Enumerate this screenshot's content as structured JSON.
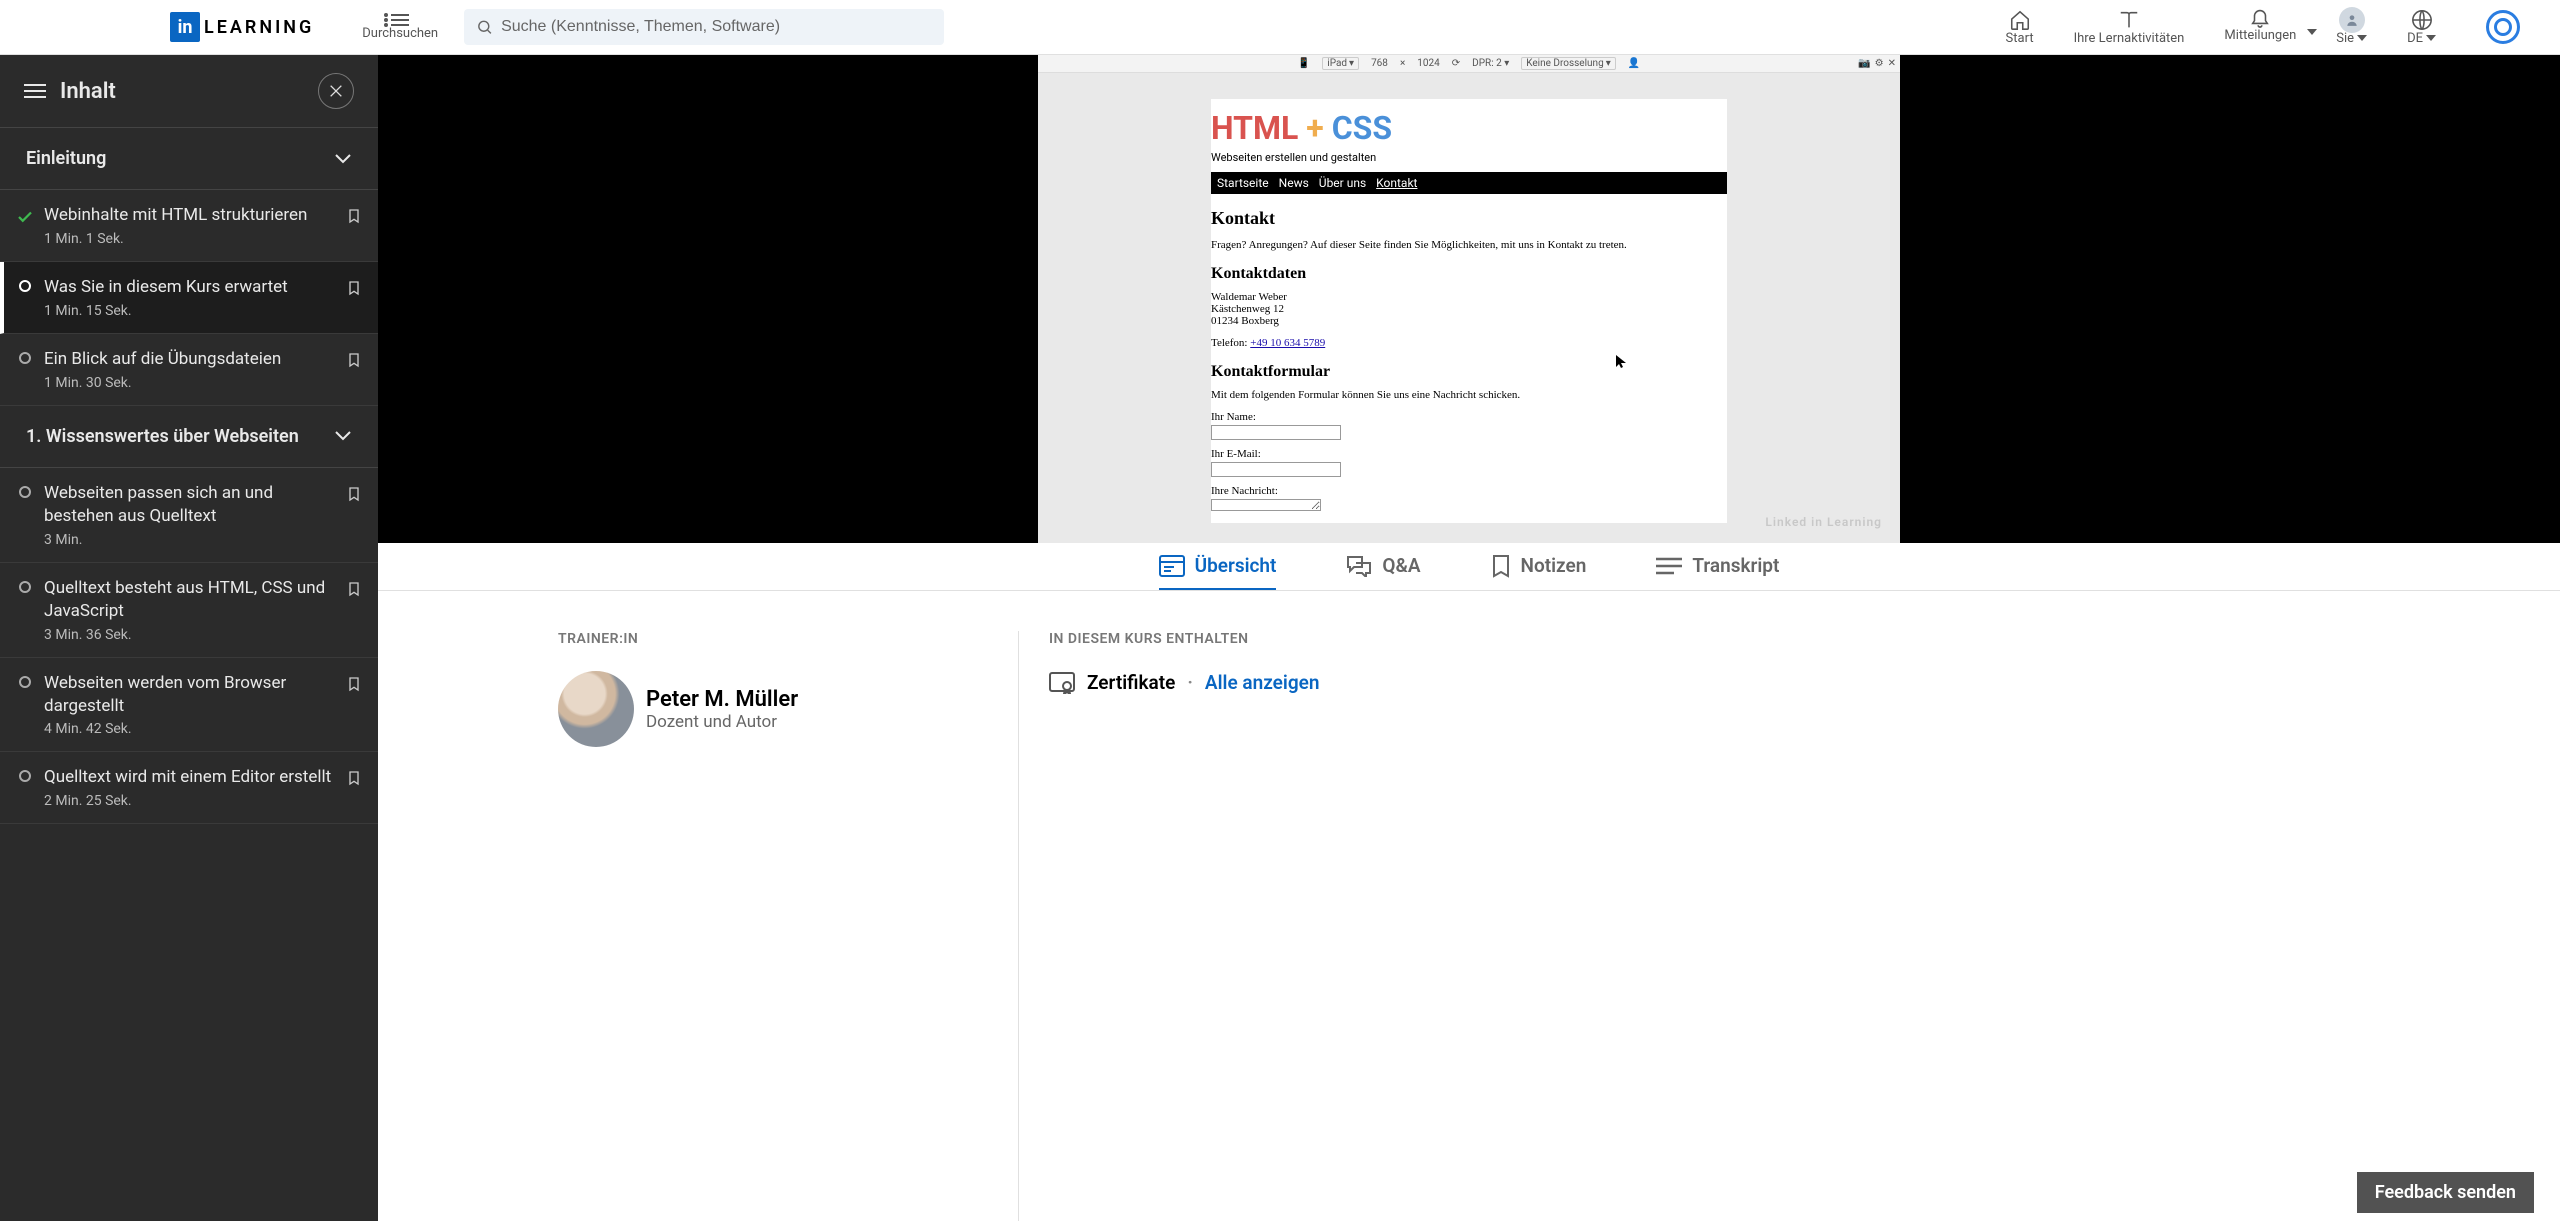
{
  "header": {
    "logo_text": "LEARNING",
    "browse": "Durchsuchen",
    "search_placeholder": "Suche (Kenntnisse, Themen, Software)",
    "nav": {
      "home": "Start",
      "mylearning": "Ihre Lernaktivitäten",
      "notifications": "Mitteilungen",
      "me": "Sie",
      "lang": "DE"
    }
  },
  "sidebar": {
    "title": "Inhalt",
    "sections": [
      {
        "title": "Einleitung",
        "lessons": [
          {
            "title": "Webinhalte mit HTML strukturieren",
            "time": "1 Min. 1 Sek.",
            "status": "done"
          },
          {
            "title": "Was Sie in diesem Kurs erwartet",
            "time": "1 Min. 15 Sek.",
            "status": "active"
          },
          {
            "title": "Ein Blick auf die Übungsdateien",
            "time": "1 Min. 30 Sek.",
            "status": "todo"
          }
        ]
      },
      {
        "title": "1. Wissenswertes über Webseiten",
        "lessons": [
          {
            "title": "Webseiten passen sich an und bestehen aus Quelltext",
            "time": "3 Min.",
            "status": "todo"
          },
          {
            "title": "Quelltext besteht aus HTML, CSS und JavaScript",
            "time": "3 Min. 36 Sek.",
            "status": "todo"
          },
          {
            "title": "Webseiten werden vom Browser dargestellt",
            "time": "4 Min. 42 Sek.",
            "status": "todo"
          },
          {
            "title": "Quelltext wird mit einem Editor erstellt",
            "time": "2 Min. 25 Sek.",
            "status": "todo"
          }
        ]
      }
    ]
  },
  "video": {
    "devbar": {
      "device": "iPad",
      "width": "768",
      "x": "×",
      "height": "1024",
      "dpr_label": "DPR:",
      "dpr": "2",
      "throttle": "Keine Drosselung"
    },
    "mock": {
      "hero_html": "HTML",
      "hero_plus": "+",
      "hero_css": "CSS",
      "subtitle": "Webseiten erstellen und gestalten",
      "nav": {
        "home": "Startseite",
        "news": "News",
        "about": "Über uns",
        "contact": "Kontakt"
      },
      "h1": "Kontakt",
      "intro": "Fragen? Anregungen? Auf dieser Seite finden Sie Möglichkeiten, mit uns in Kontakt zu treten.",
      "h2a": "Kontaktdaten",
      "name": "Waldemar Weber",
      "street": "Kästchenweg 12",
      "city": "01234 Boxberg",
      "tel_label": "Telefon: ",
      "tel": "+49 10 634 5789",
      "h2b": "Kontaktformular",
      "form_intro": "Mit dem folgenden Formular können Sie uns eine Nachricht schicken.",
      "label_name": "Ihr Name:",
      "label_email": "Ihr E-Mail:",
      "label_msg": "Ihre Nachricht:"
    },
    "watermark": "Linked in Learning"
  },
  "tabs": {
    "overview": "Übersicht",
    "qa": "Q&A",
    "notes": "Notizen",
    "transcript": "Transkript"
  },
  "below": {
    "trainer_label": "TRAINER:IN",
    "trainer_name": "Peter M. Müller",
    "trainer_role": "Dozent und Autor",
    "included_label": "IN DIESEM KURS ENTHALTEN",
    "cert": "Zertifikate",
    "show_all": "Alle anzeigen"
  },
  "feedback": "Feedback senden"
}
